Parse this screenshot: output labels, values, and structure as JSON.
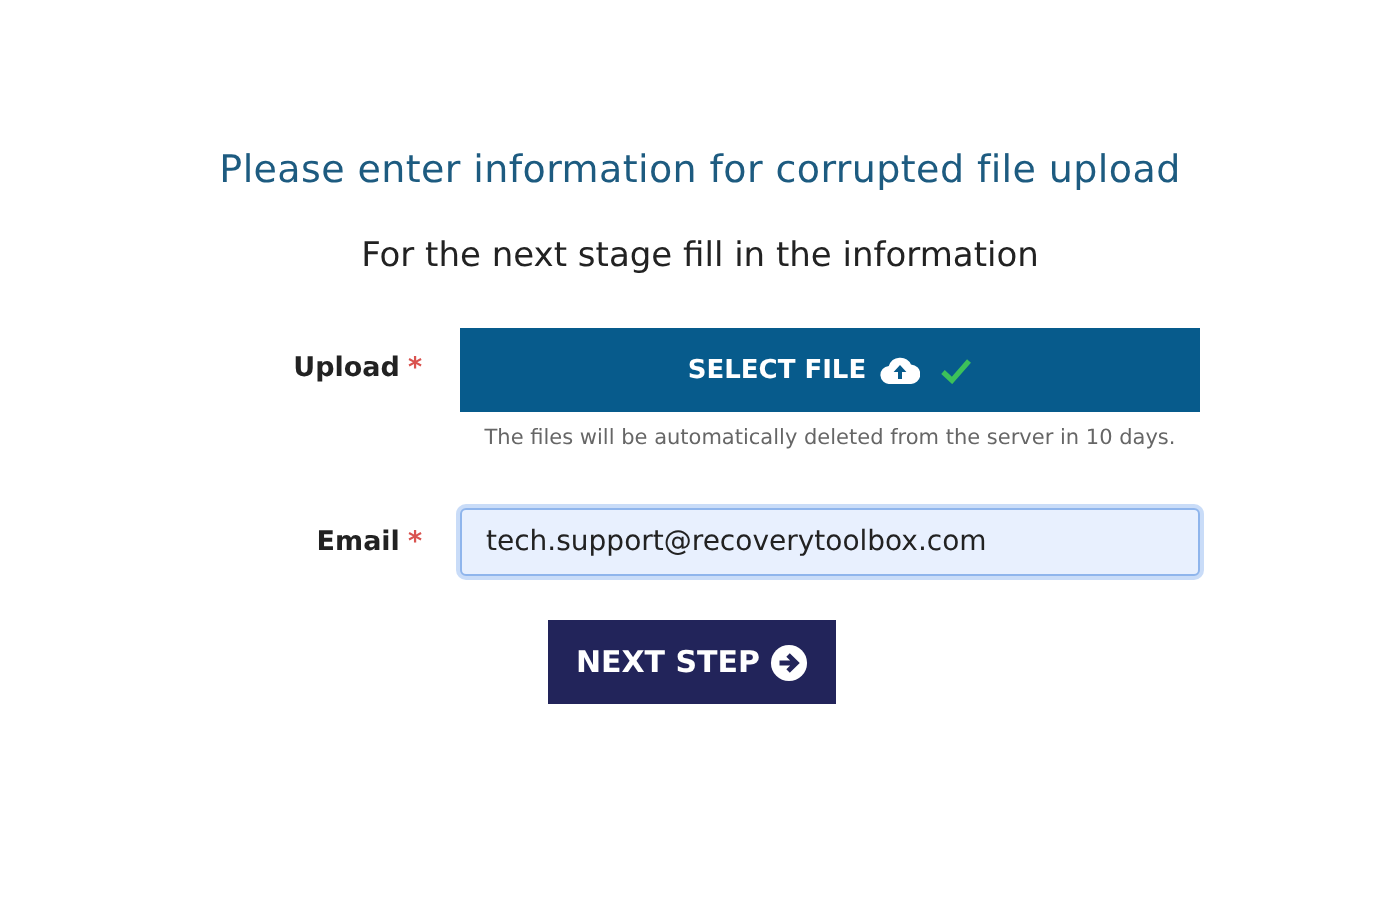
{
  "title": "Please enter information for corrupted file upload",
  "subtitle": "For the next stage fill in the information",
  "fields": [
    {
      "kind": "upload",
      "label": "Upload",
      "required_mark": "*",
      "button": "SELECT FILE",
      "uploaded": true,
      "note": "The files will be automatically deleted from the server in 10 days."
    },
    {
      "kind": "text",
      "label": "Email",
      "required_mark": "*",
      "value": "tech.support@recoverytoolbox.com",
      "focused": true
    }
  ],
  "submit": {
    "label": "NEXT STEP"
  }
}
